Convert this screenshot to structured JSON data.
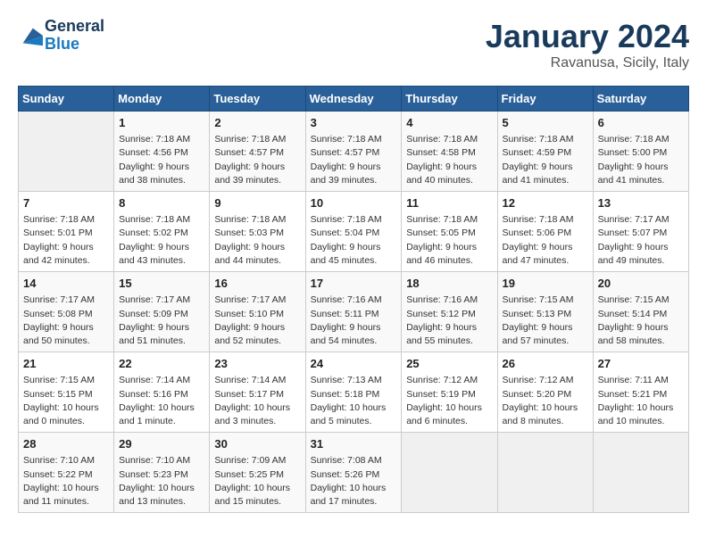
{
  "header": {
    "logo_line1": "General",
    "logo_line2": "Blue",
    "month": "January 2024",
    "location": "Ravanusa, Sicily, Italy"
  },
  "weekdays": [
    "Sunday",
    "Monday",
    "Tuesday",
    "Wednesday",
    "Thursday",
    "Friday",
    "Saturday"
  ],
  "weeks": [
    [
      {
        "day": "",
        "info": ""
      },
      {
        "day": "1",
        "info": "Sunrise: 7:18 AM\nSunset: 4:56 PM\nDaylight: 9 hours\nand 38 minutes."
      },
      {
        "day": "2",
        "info": "Sunrise: 7:18 AM\nSunset: 4:57 PM\nDaylight: 9 hours\nand 39 minutes."
      },
      {
        "day": "3",
        "info": "Sunrise: 7:18 AM\nSunset: 4:57 PM\nDaylight: 9 hours\nand 39 minutes."
      },
      {
        "day": "4",
        "info": "Sunrise: 7:18 AM\nSunset: 4:58 PM\nDaylight: 9 hours\nand 40 minutes."
      },
      {
        "day": "5",
        "info": "Sunrise: 7:18 AM\nSunset: 4:59 PM\nDaylight: 9 hours\nand 41 minutes."
      },
      {
        "day": "6",
        "info": "Sunrise: 7:18 AM\nSunset: 5:00 PM\nDaylight: 9 hours\nand 41 minutes."
      }
    ],
    [
      {
        "day": "7",
        "info": "Sunrise: 7:18 AM\nSunset: 5:01 PM\nDaylight: 9 hours\nand 42 minutes."
      },
      {
        "day": "8",
        "info": "Sunrise: 7:18 AM\nSunset: 5:02 PM\nDaylight: 9 hours\nand 43 minutes."
      },
      {
        "day": "9",
        "info": "Sunrise: 7:18 AM\nSunset: 5:03 PM\nDaylight: 9 hours\nand 44 minutes."
      },
      {
        "day": "10",
        "info": "Sunrise: 7:18 AM\nSunset: 5:04 PM\nDaylight: 9 hours\nand 45 minutes."
      },
      {
        "day": "11",
        "info": "Sunrise: 7:18 AM\nSunset: 5:05 PM\nDaylight: 9 hours\nand 46 minutes."
      },
      {
        "day": "12",
        "info": "Sunrise: 7:18 AM\nSunset: 5:06 PM\nDaylight: 9 hours\nand 47 minutes."
      },
      {
        "day": "13",
        "info": "Sunrise: 7:17 AM\nSunset: 5:07 PM\nDaylight: 9 hours\nand 49 minutes."
      }
    ],
    [
      {
        "day": "14",
        "info": "Sunrise: 7:17 AM\nSunset: 5:08 PM\nDaylight: 9 hours\nand 50 minutes."
      },
      {
        "day": "15",
        "info": "Sunrise: 7:17 AM\nSunset: 5:09 PM\nDaylight: 9 hours\nand 51 minutes."
      },
      {
        "day": "16",
        "info": "Sunrise: 7:17 AM\nSunset: 5:10 PM\nDaylight: 9 hours\nand 52 minutes."
      },
      {
        "day": "17",
        "info": "Sunrise: 7:16 AM\nSunset: 5:11 PM\nDaylight: 9 hours\nand 54 minutes."
      },
      {
        "day": "18",
        "info": "Sunrise: 7:16 AM\nSunset: 5:12 PM\nDaylight: 9 hours\nand 55 minutes."
      },
      {
        "day": "19",
        "info": "Sunrise: 7:15 AM\nSunset: 5:13 PM\nDaylight: 9 hours\nand 57 minutes."
      },
      {
        "day": "20",
        "info": "Sunrise: 7:15 AM\nSunset: 5:14 PM\nDaylight: 9 hours\nand 58 minutes."
      }
    ],
    [
      {
        "day": "21",
        "info": "Sunrise: 7:15 AM\nSunset: 5:15 PM\nDaylight: 10 hours\nand 0 minutes."
      },
      {
        "day": "22",
        "info": "Sunrise: 7:14 AM\nSunset: 5:16 PM\nDaylight: 10 hours\nand 1 minute."
      },
      {
        "day": "23",
        "info": "Sunrise: 7:14 AM\nSunset: 5:17 PM\nDaylight: 10 hours\nand 3 minutes."
      },
      {
        "day": "24",
        "info": "Sunrise: 7:13 AM\nSunset: 5:18 PM\nDaylight: 10 hours\nand 5 minutes."
      },
      {
        "day": "25",
        "info": "Sunrise: 7:12 AM\nSunset: 5:19 PM\nDaylight: 10 hours\nand 6 minutes."
      },
      {
        "day": "26",
        "info": "Sunrise: 7:12 AM\nSunset: 5:20 PM\nDaylight: 10 hours\nand 8 minutes."
      },
      {
        "day": "27",
        "info": "Sunrise: 7:11 AM\nSunset: 5:21 PM\nDaylight: 10 hours\nand 10 minutes."
      }
    ],
    [
      {
        "day": "28",
        "info": "Sunrise: 7:10 AM\nSunset: 5:22 PM\nDaylight: 10 hours\nand 11 minutes."
      },
      {
        "day": "29",
        "info": "Sunrise: 7:10 AM\nSunset: 5:23 PM\nDaylight: 10 hours\nand 13 minutes."
      },
      {
        "day": "30",
        "info": "Sunrise: 7:09 AM\nSunset: 5:25 PM\nDaylight: 10 hours\nand 15 minutes."
      },
      {
        "day": "31",
        "info": "Sunrise: 7:08 AM\nSunset: 5:26 PM\nDaylight: 10 hours\nand 17 minutes."
      },
      {
        "day": "",
        "info": ""
      },
      {
        "day": "",
        "info": ""
      },
      {
        "day": "",
        "info": ""
      }
    ]
  ]
}
